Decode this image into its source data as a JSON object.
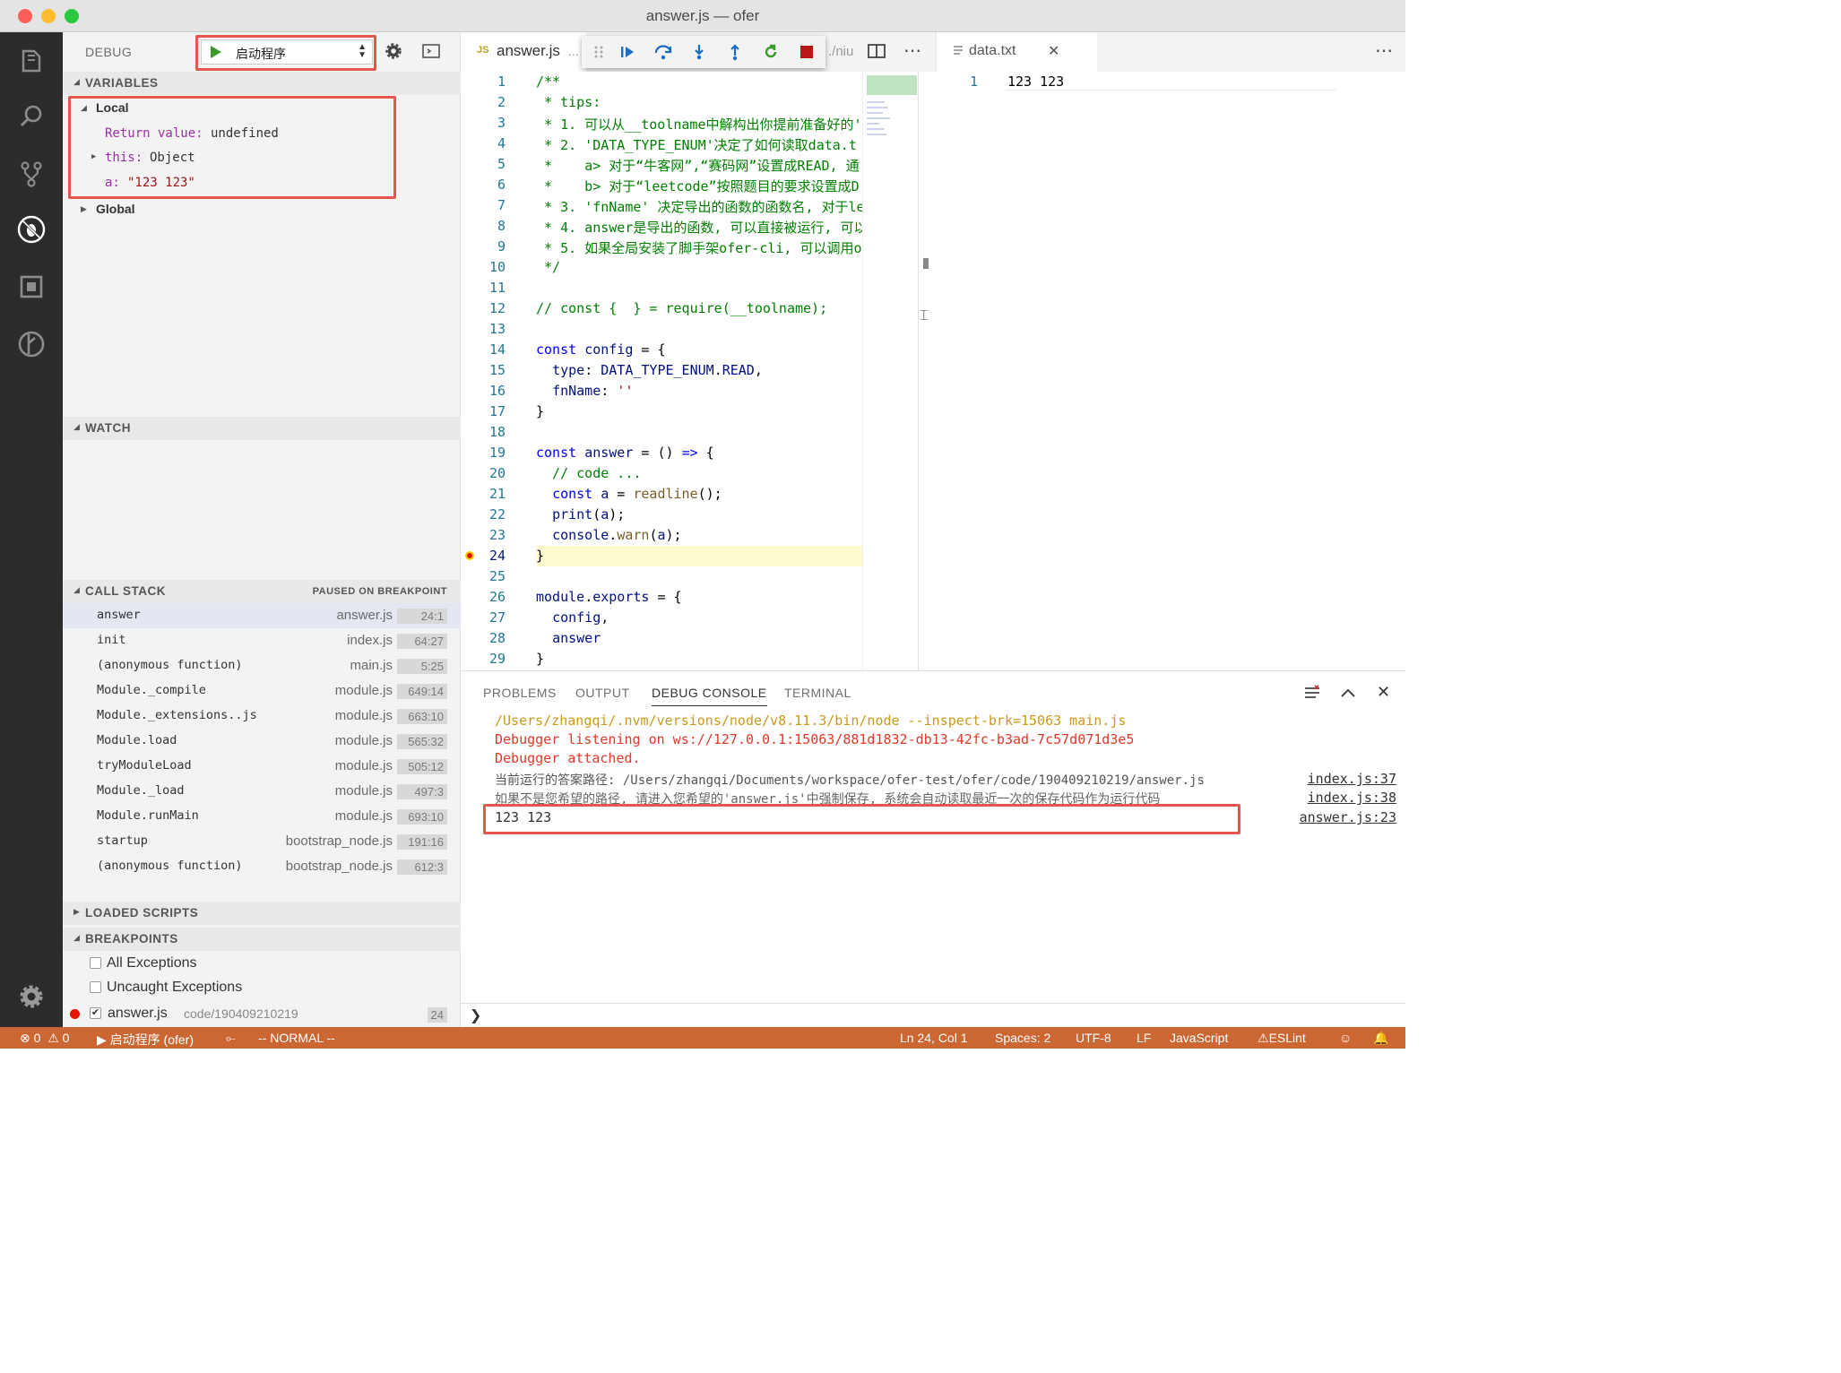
{
  "window": {
    "title": "answer.js — ofer"
  },
  "debug": {
    "header_label": "DEBUG",
    "launch_config": "启动程序"
  },
  "variables": {
    "section_label": "VARIABLES",
    "local_label": "Local",
    "return_value_key": "Return value:",
    "return_value_val": "undefined",
    "this_key": "this:",
    "this_val": "Object",
    "a_key": "a:",
    "a_val": "\"123 123\"",
    "global_label": "Global"
  },
  "watch": {
    "section_label": "WATCH"
  },
  "call_stack": {
    "section_label": "CALL STACK",
    "status": "PAUSED ON BREAKPOINT",
    "frames": [
      {
        "fn": "answer",
        "file": "answer.js",
        "pos": "24:1"
      },
      {
        "fn": "init",
        "file": "index.js",
        "pos": "64:27"
      },
      {
        "fn": "(anonymous function)",
        "file": "main.js",
        "pos": "5:25"
      },
      {
        "fn": "Module._compile",
        "file": "module.js",
        "pos": "649:14"
      },
      {
        "fn": "Module._extensions..js",
        "file": "module.js",
        "pos": "663:10"
      },
      {
        "fn": "Module.load",
        "file": "module.js",
        "pos": "565:32"
      },
      {
        "fn": "tryModuleLoad",
        "file": "module.js",
        "pos": "505:12"
      },
      {
        "fn": "Module._load",
        "file": "module.js",
        "pos": "497:3"
      },
      {
        "fn": "Module.runMain",
        "file": "module.js",
        "pos": "693:10"
      },
      {
        "fn": "startup",
        "file": "bootstrap_node.js",
        "pos": "191:16"
      },
      {
        "fn": "(anonymous function)",
        "file": "bootstrap_node.js",
        "pos": "612:3"
      }
    ]
  },
  "loaded_scripts": {
    "section_label": "LOADED SCRIPTS"
  },
  "breakpoints": {
    "section_label": "BREAKPOINTS",
    "all_exceptions": "All Exceptions",
    "uncaught_exceptions": "Uncaught Exceptions",
    "file": "answer.js",
    "path": "code/190409210219",
    "line": "24"
  },
  "editor": {
    "tab_active": "answer.js",
    "tab_active_suffix": "...",
    "tab_path_hint": "./niu",
    "tab_js_badge": "JS",
    "tab_data": "data.txt",
    "current_line": "24",
    "lines": [
      "/**",
      " * tips:",
      " * 1. 可以从__toolname中解构出你提前准备好的'",
      " * 2. 'DATA_TYPE_ENUM'决定了如何读取data.t",
      " *    a> 对于“牛客网”,“赛码网”设置成READ, 通",
      " *    b> 对于“leetcode”按照题目的要求设置成D",
      " * 3. 'fnName' 决定导出的函数的函数名, 对于le",
      " * 4. answer是导出的函数, 可以直接被运行, 可以",
      " * 5. 如果全局安装了脚手架ofer-cli, 可以调用o",
      " */",
      "",
      "// const {  } = require(__toolname);",
      "",
      "const config = {",
      "  type: DATA_TYPE_ENUM.READ,",
      "  fnName: ''",
      "}",
      "",
      "const answer = () => {",
      "  // code ...",
      "  const a = readline();",
      "  print(a);",
      "  console.warn(a);",
      "}",
      "",
      "module.exports = {",
      "  config,",
      "  answer",
      "}"
    ],
    "data_lines": [
      {
        "n": "1",
        "text": "123 123"
      }
    ]
  },
  "panel": {
    "tabs": [
      "PROBLEMS",
      "OUTPUT",
      "DEBUG CONSOLE",
      "TERMINAL"
    ],
    "console": [
      {
        "text": "/Users/zhangqi/.nvm/versions/node/v8.11.3/bin/node --inspect-brk=15063 main.js",
        "link": ""
      },
      {
        "text": "Debugger listening on ws://127.0.0.1:15063/881d1832-db13-42fc-b3ad-7c57d071d3e5",
        "link": ""
      },
      {
        "text": "Debugger attached.",
        "link": ""
      },
      {
        "text": "当前运行的答案路径: /Users/zhangqi/Documents/workspace/ofer-test/ofer/code/190409210219/answer.js",
        "link": "index.js:37"
      },
      {
        "text": "如果不是您希望的路径, 请进入您希望的'answer.js'中强制保存, 系统会自动读取最近一次的保存代码作为运行代码",
        "link": "index.js:38"
      },
      {
        "text": "123 123",
        "link": "answer.js:23"
      }
    ],
    "prompt": "❯"
  },
  "statusbar": {
    "errors": "0",
    "warnings": "0",
    "debug_target": "启动程序 (ofer)",
    "mode": "-- NORMAL --",
    "cursor": "Ln 24, Col 1",
    "spaces": "Spaces: 2",
    "encoding": "UTF-8",
    "eol": "LF",
    "language": "JavaScript",
    "eslint": "ESLint"
  }
}
